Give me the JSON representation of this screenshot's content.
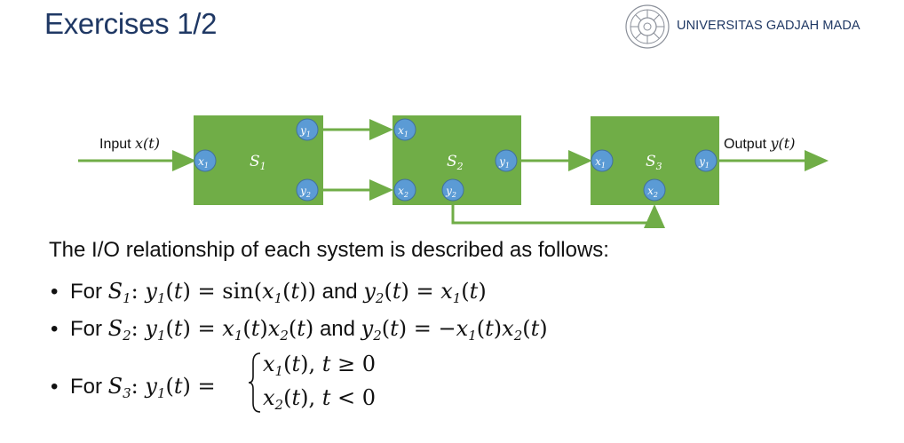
{
  "slide": {
    "title": "Exercises 1/2",
    "university": "UNIVERSITAS GADJAH MADA"
  },
  "diagram": {
    "input_label": "Input ",
    "input_var": "x(t)",
    "output_label": "Output ",
    "output_var": "y(t)",
    "systems": [
      {
        "name": "S",
        "sub": "1",
        "ports": {
          "in": [
            "x1"
          ],
          "out": [
            "y1",
            "y2"
          ]
        }
      },
      {
        "name": "S",
        "sub": "2",
        "ports": {
          "in": [
            "x1",
            "x2"
          ],
          "out": [
            "y1",
            "y2"
          ]
        }
      },
      {
        "name": "S",
        "sub": "3",
        "ports": {
          "in": [
            "x1",
            "x2"
          ],
          "out": [
            "y1"
          ]
        }
      }
    ],
    "colors": {
      "block": "#70ad47",
      "port": "#5b9bd5",
      "arrow": "#70ad47"
    }
  },
  "text": {
    "intro": "The I/O relationship of each system is described as follows:",
    "for_word": "For",
    "and_word": "and",
    "bullets": [
      {
        "system": "S1",
        "eq1": "y1(t) = sin(x1(t))",
        "eq2": "y2(t) = x1(t)"
      },
      {
        "system": "S2",
        "eq1": "y1(t) = x1(t)x2(t)",
        "eq2": "y2(t) = −x1(t)x2(t)"
      },
      {
        "system": "S3",
        "eq1": "y1(t) =",
        "cases": [
          "x1(t), t ≥ 0",
          "x2(t), t < 0"
        ]
      }
    ]
  }
}
